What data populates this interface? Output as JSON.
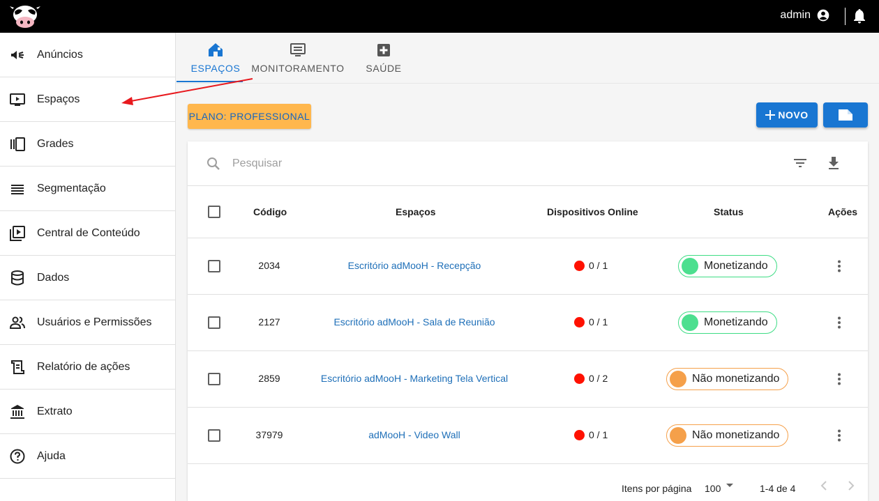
{
  "topbar": {
    "user_name": "admin"
  },
  "sidebar": {
    "items": [
      {
        "label": "Anúncios",
        "icon": "megaphone-icon"
      },
      {
        "label": "Espaços",
        "icon": "tv-play-icon"
      },
      {
        "label": "Grades",
        "icon": "grid-panels-icon"
      },
      {
        "label": "Segmentação",
        "icon": "list-lines-icon"
      },
      {
        "label": "Central de Conteúdo",
        "icon": "video-library-icon"
      },
      {
        "label": "Dados",
        "icon": "database-icon"
      },
      {
        "label": "Usuários e Permissões",
        "icon": "people-icon"
      },
      {
        "label": "Relatório de ações",
        "icon": "report-icon"
      },
      {
        "label": "Extrato",
        "icon": "bank-icon"
      },
      {
        "label": "Ajuda",
        "icon": "help-icon"
      }
    ]
  },
  "tabs": [
    {
      "label": "ESPAÇOS",
      "icon": "home-icon",
      "active": true
    },
    {
      "label": "MONITORAMENTO",
      "icon": "monitor-icon",
      "active": false
    },
    {
      "label": "SAÚDE",
      "icon": "plus-square-icon",
      "active": false
    }
  ],
  "plan_label": "PLANO: PROFESSIONAL",
  "new_button_label": "NOVO",
  "search": {
    "placeholder": "Pesquisar"
  },
  "table": {
    "headers": {
      "code": "Código",
      "spaces": "Espaços",
      "devices": "Dispositivos Online",
      "status": "Status",
      "actions": "Ações"
    },
    "rows": [
      {
        "code": "2034",
        "name": "Escritório adMooH - Recepção",
        "devices": "0 / 1",
        "status": "Monetizando",
        "status_kind": "green"
      },
      {
        "code": "2127",
        "name": "Escritório adMooH - Sala de Reunião",
        "devices": "0 / 1",
        "status": "Monetizando",
        "status_kind": "green"
      },
      {
        "code": "2859",
        "name": "Escritório adMooH - Marketing Tela Vertical",
        "devices": "0 / 2",
        "status": "Não monetizando",
        "status_kind": "orange"
      },
      {
        "code": "37979",
        "name": "adMooH - Video Wall",
        "devices": "0 / 1",
        "status": "Não monetizando",
        "status_kind": "orange"
      }
    ]
  },
  "pagination": {
    "items_per_page_label": "Itens por página",
    "items_per_page": "100",
    "range": "1-4 de 4"
  },
  "colors": {
    "primary": "#1976d2",
    "plan_bg": "#ffb74d",
    "online_dot": "#ff1100",
    "green": "#4cdf8f",
    "orange": "#f5a04a"
  }
}
